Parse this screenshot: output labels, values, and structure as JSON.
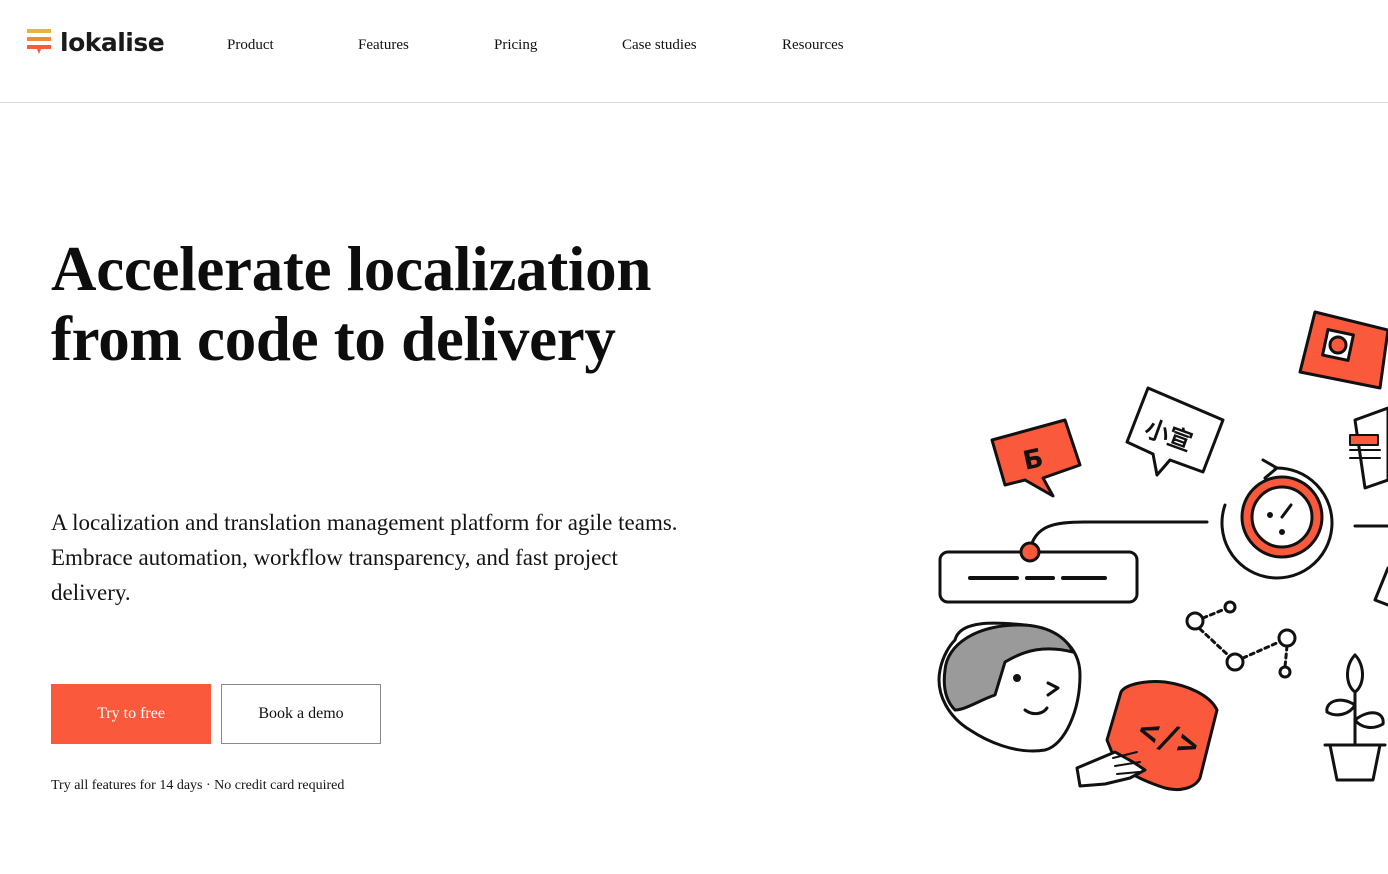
{
  "brand": {
    "name": "lokalise",
    "colors": {
      "accent": "#fa5a3b",
      "logo_top": "#e8b43a",
      "logo_mid": "#f08a3a",
      "logo_bottom": "#fa5a3b"
    }
  },
  "nav": {
    "items": [
      {
        "label": "Product"
      },
      {
        "label": "Features"
      },
      {
        "label": "Pricing"
      },
      {
        "label": "Case studies"
      },
      {
        "label": "Resources"
      }
    ]
  },
  "hero": {
    "title_line1": "Accelerate localization",
    "title_line2": "from code to delivery",
    "subtitle": "A localization and translation management platform for agile teams. Embrace automation, workflow transparency, and fast project delivery.",
    "primary_cta": "Try to free",
    "secondary_cta": "Book a demo",
    "note": "Try all features for 14 days · No credit card required"
  },
  "illustration": {
    "glyph_cyrillic": "Б",
    "glyph_chinese": "小宣",
    "code_symbol": "</>",
    "icons": [
      "flag-icon",
      "speech-bubble-icon",
      "clock-icon",
      "keyboard-icon",
      "person-icon",
      "code-tag-icon",
      "network-icon",
      "plant-icon"
    ]
  }
}
